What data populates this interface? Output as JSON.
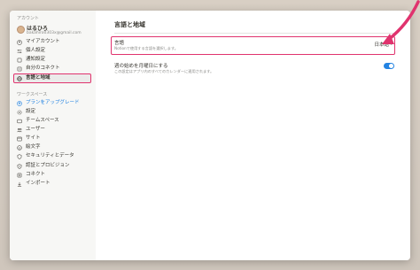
{
  "sidebar": {
    "account_section": "アカウント",
    "user": {
      "name": "はるひろ",
      "email": "bakahiro0303x@gmail.com"
    },
    "account_items": [
      {
        "label": "マイアカウント",
        "icon": "user-circle-icon"
      },
      {
        "label": "個人設定",
        "icon": "sliders-icon"
      },
      {
        "label": "通知設定",
        "icon": "bell-icon"
      },
      {
        "label": "自分のコネクト",
        "icon": "connections-icon"
      },
      {
        "label": "言語と地域",
        "icon": "globe-icon",
        "active": true
      }
    ],
    "workspace_section": "ワークスペース",
    "workspace_items": [
      {
        "label": "プランをアップグレード",
        "icon": "upgrade-icon",
        "accent": true
      },
      {
        "label": "設定",
        "icon": "gear-icon"
      },
      {
        "label": "チームスペース",
        "icon": "teamspace-icon"
      },
      {
        "label": "ユーザー",
        "icon": "users-icon"
      },
      {
        "label": "サイト",
        "icon": "site-icon"
      },
      {
        "label": "絵文字",
        "icon": "emoji-icon"
      },
      {
        "label": "セキュリティとデータ",
        "icon": "shield-icon"
      },
      {
        "label": "認証とプロビジョン",
        "icon": "key-icon"
      },
      {
        "label": "コネクト",
        "icon": "connect-icon"
      },
      {
        "label": "インポート",
        "icon": "import-icon"
      }
    ]
  },
  "main": {
    "title": "言語と地域",
    "language": {
      "title": "言語",
      "description": "Notionで使用する言語を選択します。",
      "value": "日本語"
    },
    "week_start": {
      "title": "週の始めを月曜日にする",
      "description": "この設定はアプリ内のすべてのカレンダーに適用されます。",
      "enabled": true
    }
  },
  "colors": {
    "highlight": "#e0336e",
    "accent": "#2383e2"
  }
}
